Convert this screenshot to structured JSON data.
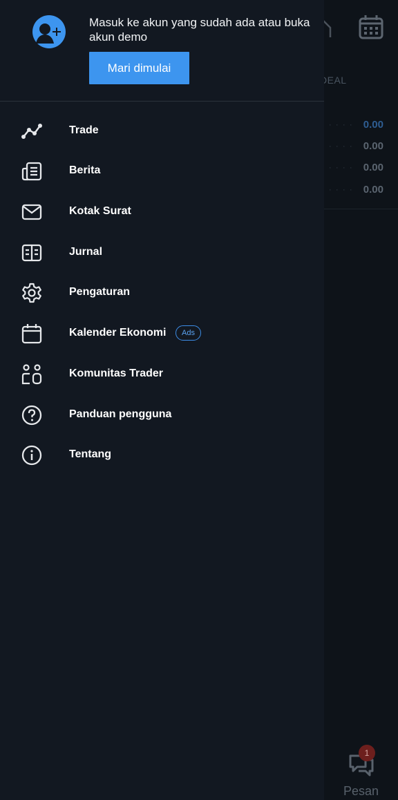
{
  "background": {
    "column_header": "DEAL",
    "rows": [
      {
        "value": "0.00",
        "accent": true
      },
      {
        "value": "0.00",
        "accent": false
      },
      {
        "value": "0.00",
        "accent": false
      },
      {
        "value": "0.00",
        "accent": false
      }
    ],
    "messages": {
      "label": "Pesan",
      "badge_count": "1"
    }
  },
  "drawer": {
    "header": {
      "prompt_text": "Masuk ke akun yang sudah ada atau buka akun demo",
      "start_button_label": "Mari dimulai"
    },
    "menu_items": [
      {
        "label": "Trade",
        "icon": "trade-chart-icon"
      },
      {
        "label": "Berita",
        "icon": "news-icon"
      },
      {
        "label": "Kotak Surat",
        "icon": "mail-icon"
      },
      {
        "label": "Jurnal",
        "icon": "journal-icon"
      },
      {
        "label": "Pengaturan",
        "icon": "gear-icon"
      },
      {
        "label": "Kalender Ekonomi",
        "icon": "calendar-icon",
        "badge": "Ads"
      },
      {
        "label": "Komunitas Trader",
        "icon": "community-icon"
      },
      {
        "label": "Panduan pengguna",
        "icon": "help-icon"
      },
      {
        "label": "Tentang",
        "icon": "info-icon"
      }
    ]
  },
  "colors": {
    "accent": "#3d95ef",
    "drawer_bg": "#121821",
    "ads_badge": "#3d8ee8"
  }
}
